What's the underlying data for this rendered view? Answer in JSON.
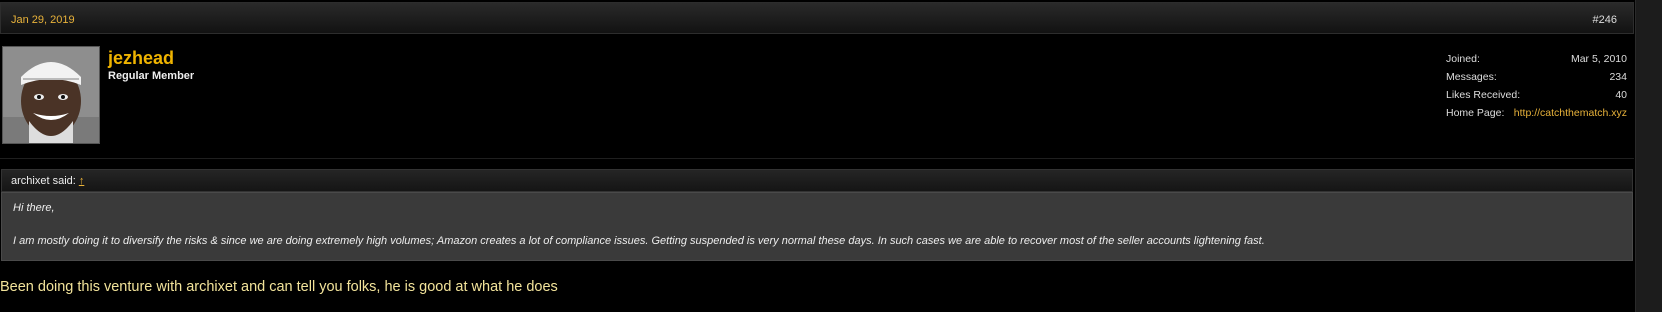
{
  "post": {
    "date": "Jan 29, 2019",
    "number": "#246"
  },
  "user": {
    "name": "jezhead",
    "title": "Regular Member"
  },
  "stats": [
    {
      "label": "Joined:",
      "value": "Mar 5, 2010"
    },
    {
      "label": "Messages:",
      "value": "234"
    },
    {
      "label": "Likes Received:",
      "value": "40"
    },
    {
      "label": "Home Page:",
      "value": "http://catchthematch.xyz"
    }
  ],
  "quote": {
    "author": "archixet said:",
    "arrow": "↑",
    "line1": "Hi there,",
    "line2": "I am mostly doing it to diversify the risks & since we are doing extremely high volumes; Amazon creates a lot of compliance issues. Getting suspended is very normal these days. In such cases we are able to recover most of the seller accounts lightening fast."
  },
  "message": "Been doing this venture with archixet and can tell you folks, he is good at what he does",
  "colors": {
    "accent": "#e8b23a",
    "username": "#f0b400",
    "message": "#f2e39a",
    "quote_bg": "#3a3a3a"
  }
}
